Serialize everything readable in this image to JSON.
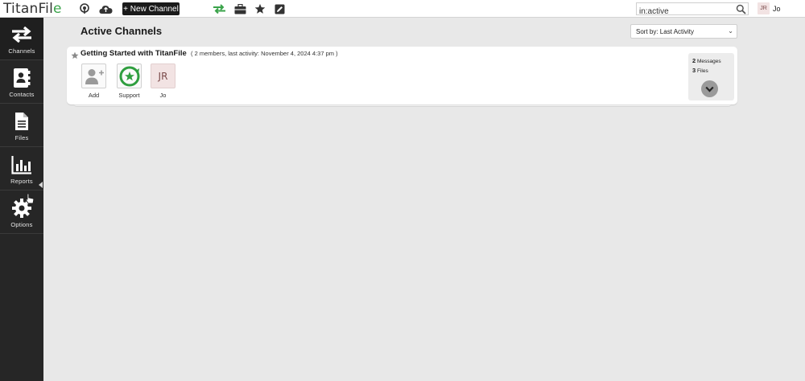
{
  "app": {
    "logo_text": "TitanFil",
    "logo_accent": "e",
    "accent_color": "#3aa34a"
  },
  "topbar": {
    "new_channel_label": "+ New Channel",
    "icons": [
      "podcast-icon",
      "cloud-icon",
      "transfer-icon",
      "briefcase-icon",
      "star-icon",
      "edit-icon"
    ],
    "search": {
      "value": "in:active"
    },
    "user": {
      "initials": "JR",
      "name": "Jo"
    }
  },
  "sidebar": {
    "items": [
      {
        "label": "Channels",
        "icon": "transfer-arrows-icon"
      },
      {
        "label": "Contacts",
        "icon": "contacts-book-icon"
      },
      {
        "label": "Files",
        "icon": "file-icon"
      },
      {
        "label": "Reports",
        "icon": "bar-chart-icon"
      },
      {
        "label": "Options",
        "icon": "gear-icon"
      }
    ]
  },
  "main": {
    "title": "Active Channels",
    "sort": {
      "selected": "Sort by: Last Activity"
    },
    "channels": [
      {
        "name": "Getting Started with TitanFile",
        "meta": "( 2 members, last activity: November 4, 2024 4:37 pm )",
        "members": [
          {
            "name": "Add",
            "kind": "add-member-icon"
          },
          {
            "name": "Support",
            "kind": "support-logo"
          },
          {
            "name": "Jo",
            "initials": "JR"
          }
        ],
        "stats": {
          "messages_count": "2",
          "messages_label": "Messages",
          "files_count": "3",
          "files_label": "Files"
        }
      }
    ]
  }
}
